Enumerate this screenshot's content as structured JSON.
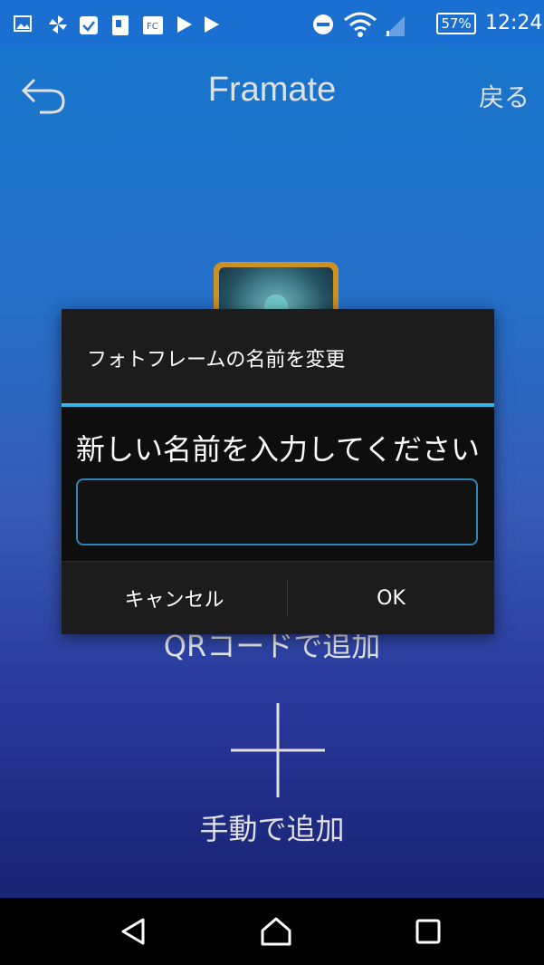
{
  "status_bar": {
    "battery": "57%",
    "time": "12:24",
    "notification_icons": [
      "image-icon",
      "pinwheel-icon",
      "check-icon",
      "sim-icon",
      "fc-icon",
      "play-icon",
      "play-icon"
    ]
  },
  "header": {
    "title": "Framate",
    "back_text": "戻る"
  },
  "background": {
    "qr_label": "QRコードで追加",
    "manual_label": "手動で追加"
  },
  "dialog": {
    "title": "フォトフレームの名前を変更",
    "message": "新しい名前を入力してください",
    "input_value": "",
    "cancel_label": "キャンセル",
    "ok_label": "OK"
  },
  "colors": {
    "status_bar": "#1a6fd1",
    "accent": "#33b5e5",
    "frame": "#e9a42a"
  }
}
